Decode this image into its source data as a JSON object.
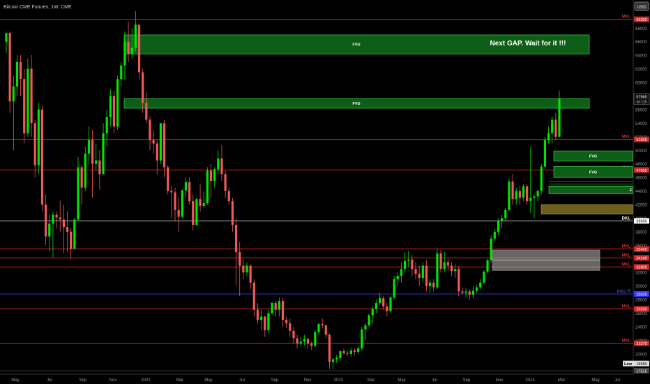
{
  "header": {
    "symbol_title": "Bitcoin CME Futures, 1W, CME",
    "currency_button": "USD"
  },
  "chart_data": {
    "type": "candlestick",
    "title": "Bitcoin CME Futures, 1W, CME",
    "ylim": [
      17000,
      71000
    ],
    "y_ticks": [
      20000,
      22000,
      24000,
      26000,
      28000,
      30000,
      32000,
      34000,
      36000,
      38000,
      40000,
      42000,
      44000,
      46000,
      48000,
      50000,
      52000,
      54000,
      56000,
      58000,
      60000,
      62000,
      64000,
      66000,
      68000
    ],
    "x_ticks": [
      "May",
      "Jul",
      "Sep",
      "Nov",
      "2022",
      "Mar",
      "May",
      "Jul",
      "Sep",
      "Nov",
      "2023",
      "Mar",
      "May",
      "Jul",
      "Sep",
      "Nov",
      "2024",
      "Mar",
      "May",
      "Jul"
    ],
    "colors": {
      "up": "#00e600",
      "down": "#f05a5a",
      "level": "#ff2a2a",
      "fvg_fill": "#0d5e16",
      "fvg_border": "#35c045",
      "dkl_line": "#dddddd",
      "intro_line": "#3a3aff",
      "gold_zone": "#6b5d1b",
      "gray_zone": "#bbbbbb"
    },
    "horizontal_levels": [
      {
        "label": "MKL",
        "value": 69300,
        "badge": "69300"
      },
      {
        "label": "MKL",
        "value": 51605,
        "badge": "51605"
      },
      {
        "label": "MKL",
        "value": 47095,
        "badge": "47095"
      },
      {
        "label": "DKL",
        "value": 39600,
        "badge": "39600"
      },
      {
        "label": "MKL",
        "value": 35450,
        "badge": "35450"
      },
      {
        "label": "MKL",
        "value": 34140,
        "badge": "34140"
      },
      {
        "label": "MKL",
        "value": 32805,
        "badge": "32805"
      },
      {
        "label": "Intro. P",
        "value": 28835,
        "badge": "28835"
      },
      {
        "label": "MKL",
        "value": 26630,
        "badge": "26630"
      },
      {
        "label": "MKL",
        "value": 21570,
        "badge": "21570"
      },
      {
        "label": "",
        "value": 17515,
        "badge": "17515"
      }
    ],
    "current_price": {
      "value": "57560",
      "countdown": "3d 12h"
    },
    "low_marker": {
      "label": "Low",
      "value": "18580"
    },
    "zones": [
      {
        "label": "FVG",
        "type": "fvg",
        "y_range": [
          64200,
          67000
        ]
      },
      {
        "label": "FVG",
        "type": "fvg",
        "y_range": [
          56200,
          57600
        ]
      },
      {
        "label": "FVG",
        "type": "fvg",
        "y_range": [
          48400,
          49900
        ]
      },
      {
        "label": "FVG",
        "type": "fvg",
        "y_range": [
          46000,
          47600
        ]
      },
      {
        "label": "F",
        "type": "fvg",
        "y_range": [
          43600,
          44700
        ]
      },
      {
        "label": "",
        "type": "gold",
        "y_range": [
          40600,
          42000
        ]
      },
      {
        "label": "",
        "type": "gray",
        "y_range": [
          32300,
          35300
        ]
      }
    ],
    "annotation": "Next GAP. Wait for it  !!!",
    "candles": [
      [
        null,
        66000,
        67300,
        64300,
        67300
      ],
      [
        null,
        67300,
        67500,
        55500,
        57200
      ],
      [
        null,
        57200,
        61000,
        50000,
        59400
      ],
      [
        null,
        59400,
        64000,
        58000,
        63000
      ],
      [
        null,
        63000,
        64000,
        58000,
        60500
      ],
      [
        null,
        60500,
        62000,
        51000,
        52500
      ],
      [
        null,
        52500,
        63500,
        52000,
        62000
      ],
      [
        null,
        62000,
        64000,
        52000,
        54000
      ],
      [
        null,
        54000,
        54500,
        46000,
        47800
      ],
      [
        null,
        47800,
        57000,
        46500,
        56000
      ],
      [
        null,
        56000,
        56500,
        41000,
        42000
      ],
      [
        null,
        42000,
        43500,
        36000,
        37300
      ],
      [
        null,
        37300,
        40600,
        35000,
        39200
      ],
      [
        null,
        39200,
        41000,
        34200,
        40500
      ],
      [
        null,
        40500,
        41000,
        38500,
        40100
      ],
      [
        null,
        40100,
        42600,
        38000,
        39800
      ],
      [
        null,
        39800,
        42000,
        34800,
        38700
      ],
      [
        null,
        38700,
        41000,
        35000,
        38000
      ],
      [
        null,
        38000,
        38500,
        34000,
        35500
      ],
      [
        null,
        35500,
        40000,
        35500,
        39800
      ],
      [
        null,
        39800,
        49000,
        39500,
        47500
      ],
      [
        null,
        47500,
        47800,
        42000,
        44500
      ],
      [
        null,
        44500,
        50500,
        44000,
        49500
      ],
      [
        null,
        49500,
        53500,
        48000,
        51500
      ],
      [
        null,
        51500,
        53000,
        43000,
        48000
      ],
      [
        null,
        48000,
        51000,
        47000,
        48500
      ],
      [
        null,
        48500,
        50000,
        44200,
        46500
      ],
      [
        null,
        46500,
        54000,
        46500,
        52500
      ],
      [
        null,
        52500,
        56000,
        50500,
        54900
      ],
      [
        null,
        54900,
        59000,
        53500,
        58000
      ],
      [
        null,
        58000,
        58800,
        52500,
        53500
      ],
      [
        null,
        53500,
        61000,
        53000,
        60500
      ],
      [
        null,
        60500,
        63000,
        59500,
        62500
      ],
      [
        null,
        62500,
        67500,
        60500,
        66000
      ],
      [
        null,
        66000,
        69000,
        63000,
        64200
      ],
      [
        null,
        64200,
        68000,
        63500,
        65100
      ],
      [
        null,
        65100,
        70500,
        64500,
        68500
      ],
      [
        null,
        68500,
        68500,
        60500,
        61500
      ],
      [
        null,
        61500,
        62000,
        55500,
        57000
      ],
      [
        null,
        57000,
        58500,
        54000,
        54500
      ],
      [
        null,
        54500,
        55000,
        50000,
        51500
      ],
      [
        null,
        51500,
        53000,
        49500,
        51000
      ],
      [
        null,
        51000,
        51500,
        46500,
        48500
      ],
      [
        null,
        48500,
        54000,
        48000,
        54000
      ],
      [
        null,
        54000,
        54500,
        46000,
        47500
      ],
      [
        null,
        47500,
        47800,
        43500,
        44000
      ],
      [
        null,
        44000,
        44800,
        40000,
        43800
      ],
      [
        null,
        43800,
        44500,
        39500,
        41200
      ],
      [
        null,
        41200,
        43000,
        38000,
        40200
      ],
      [
        null,
        40200,
        44300,
        40000,
        44100
      ],
      [
        null,
        44100,
        46000,
        43000,
        45300
      ],
      [
        null,
        45300,
        46000,
        42000,
        42500
      ],
      [
        null,
        42500,
        43500,
        38200,
        39000
      ],
      [
        null,
        39000,
        43000,
        38800,
        42800
      ],
      [
        null,
        42800,
        45000,
        41000,
        41800
      ],
      [
        null,
        41800,
        44000,
        41500,
        42200
      ],
      [
        null,
        42200,
        47500,
        42000,
        47000
      ],
      [
        null,
        47000,
        48000,
        43000,
        45500
      ],
      [
        null,
        45500,
        47500,
        44500,
        47200
      ],
      [
        null,
        47200,
        50000,
        46500,
        48800
      ],
      [
        null,
        48800,
        50800,
        45500,
        46500
      ],
      [
        null,
        46500,
        47000,
        43000,
        44000
      ],
      [
        null,
        44000,
        44500,
        42000,
        42500
      ],
      [
        null,
        42500,
        43000,
        38000,
        39000
      ],
      [
        null,
        39000,
        40000,
        30000,
        35000
      ],
      [
        null,
        35000,
        36500,
        28500,
        33000
      ],
      [
        null,
        33000,
        34000,
        31000,
        32000
      ],
      [
        null,
        32000,
        33500,
        31500,
        33000
      ],
      [
        null,
        33000,
        33200,
        29500,
        30500
      ],
      [
        null,
        30500,
        31000,
        25500,
        26500
      ],
      [
        null,
        26500,
        27500,
        24500,
        25000
      ],
      [
        null,
        25000,
        26500,
        23500,
        25500
      ],
      [
        null,
        25500,
        25600,
        22500,
        23500
      ],
      [
        null,
        23500,
        26500,
        23000,
        26000
      ],
      [
        null,
        26000,
        27600,
        25800,
        27500
      ],
      [
        null,
        27500,
        27800,
        25500,
        26500
      ],
      [
        null,
        26500,
        28300,
        25500,
        27800
      ],
      [
        null,
        27800,
        28200,
        24000,
        25000
      ],
      [
        null,
        25000,
        25500,
        23800,
        24500
      ],
      [
        null,
        24500,
        25200,
        22500,
        23400
      ],
      [
        null,
        23400,
        24000,
        21500,
        22300
      ],
      [
        null,
        22300,
        22800,
        20800,
        21500
      ],
      [
        null,
        21500,
        22500,
        21200,
        21800
      ],
      [
        null,
        21800,
        22800,
        21300,
        22200
      ],
      [
        null,
        22200,
        22300,
        20800,
        21500
      ],
      [
        null,
        21500,
        21800,
        20600,
        21200
      ],
      [
        null,
        21200,
        23500,
        21000,
        23200
      ],
      [
        null,
        23200,
        24600,
        22800,
        24400
      ],
      [
        null,
        24400,
        25200,
        23800,
        24200
      ],
      [
        null,
        24200,
        24300,
        22300,
        22800
      ],
      [
        null,
        22800,
        23000,
        17800,
        18800
      ],
      [
        null,
        18800,
        19500,
        17800,
        19200
      ],
      [
        null,
        19200,
        19800,
        18700,
        19400
      ],
      [
        null,
        19400,
        20500,
        19000,
        20400
      ],
      [
        null,
        20400,
        20800,
        19900,
        20100
      ],
      [
        null,
        20100,
        20500,
        19700,
        20000
      ],
      [
        null,
        20000,
        20900,
        19600,
        20500
      ],
      [
        null,
        20500,
        20800,
        19800,
        20300
      ],
      [
        null,
        20300,
        21200,
        19900,
        20800
      ],
      [
        null,
        20800,
        24000,
        20500,
        23600
      ],
      [
        null,
        23600,
        24500,
        22000,
        24200
      ],
      [
        null,
        24200,
        26000,
        24000,
        25700
      ],
      [
        null,
        25700,
        27000,
        24500,
        26600
      ],
      [
        null,
        26600,
        28000,
        26000,
        27500
      ],
      [
        null,
        27500,
        29000,
        27200,
        28200
      ],
      [
        null,
        28200,
        28500,
        26500,
        27000
      ],
      [
        null,
        27000,
        27500,
        25500,
        26300
      ],
      [
        null,
        26300,
        28500,
        26000,
        28300
      ],
      [
        null,
        28300,
        31500,
        28000,
        31000
      ],
      [
        null,
        31000,
        32000,
        30000,
        31500
      ],
      [
        null,
        31500,
        33500,
        30500,
        32500
      ],
      [
        null,
        32500,
        35000,
        32000,
        33700
      ],
      [
        null,
        33700,
        35200,
        32800,
        33900
      ],
      [
        null,
        33900,
        34500,
        31500,
        32500
      ],
      [
        null,
        32500,
        33500,
        31000,
        31800
      ],
      [
        null,
        31800,
        33000,
        30000,
        31200
      ],
      [
        null,
        31200,
        33500,
        30600,
        33000
      ],
      [
        null,
        33000,
        33800,
        29200,
        30000
      ],
      [
        null,
        30000,
        31000,
        29000,
        30500
      ],
      [
        null,
        30500,
        31000,
        29200,
        29800
      ],
      [
        null,
        29800,
        35500,
        29500,
        34800
      ],
      [
        null,
        34800,
        35300,
        32000,
        32500
      ],
      [
        null,
        32500,
        35000,
        32000,
        33500
      ],
      [
        null,
        33500,
        34000,
        32200,
        33000
      ],
      [
        null,
        33000,
        33500,
        31500,
        32200
      ],
      [
        null,
        32200,
        33200,
        31200,
        32500
      ],
      [
        null,
        32500,
        33000,
        28500,
        29200
      ],
      [
        null,
        29200,
        29800,
        28800,
        29000
      ],
      [
        null,
        29000,
        29700,
        28300,
        29200
      ],
      [
        null,
        29200,
        29500,
        28000,
        28700
      ],
      [
        null,
        28700,
        30000,
        28200,
        29300
      ],
      [
        null,
        29300,
        30200,
        29000,
        29800
      ],
      [
        null,
        29800,
        31000,
        29500,
        30500
      ],
      [
        null,
        30500,
        32300,
        30300,
        32100
      ],
      [
        null,
        32100,
        34000,
        31800,
        33800
      ],
      [
        null,
        33800,
        37500,
        33500,
        37000
      ],
      [
        null,
        37000,
        38400,
        36500,
        38000
      ],
      [
        null,
        38000,
        40000,
        37500,
        39600
      ],
      [
        null,
        39600,
        40500,
        38500,
        40000
      ],
      [
        null,
        40000,
        41500,
        39500,
        41200
      ],
      [
        null,
        41200,
        45800,
        41000,
        45400
      ],
      [
        null,
        45400,
        46500,
        42000,
        42800
      ],
      [
        null,
        42800,
        44500,
        42000,
        44000
      ],
      [
        null,
        44000,
        44800,
        42000,
        43000
      ],
      [
        null,
        43000,
        45000,
        42500,
        44700
      ],
      [
        null,
        44700,
        45000,
        42000,
        42500
      ],
      [
        null,
        42500,
        50500,
        40800,
        43000
      ],
      [
        null,
        43000,
        43500,
        40000,
        43200
      ],
      [
        null,
        43200,
        44200,
        42500,
        44000
      ],
      [
        null,
        44000,
        48000,
        43500,
        47600
      ],
      [
        null,
        47600,
        52000,
        47500,
        51500
      ],
      [
        null,
        51500,
        53500,
        51000,
        52500
      ],
      [
        null,
        52500,
        55000,
        51000,
        54500
      ],
      [
        null,
        54500,
        55500,
        51500,
        52000
      ],
      [
        null,
        52000,
        58800,
        52000,
        57600
      ]
    ]
  }
}
